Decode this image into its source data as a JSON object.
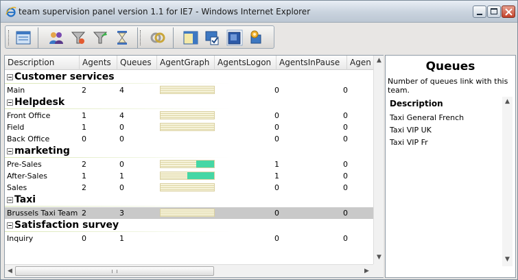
{
  "window": {
    "title": "team supervision panel version 1.1 for IE7 - Windows Internet Explorer"
  },
  "toolbar": {
    "icons": [
      "layout-icon",
      "team-icon",
      "funnel-icon",
      "filter-icon",
      "hourglass-icon",
      "rings-icon",
      "panel-icon",
      "checkbox-icon",
      "window-icon",
      "settings-icon"
    ]
  },
  "grid": {
    "columns": [
      "Description",
      "Agents",
      "Queues",
      "AgentGraph",
      "AgentsLogon",
      "AgentsInPause",
      "Agen"
    ],
    "groups": [
      {
        "name": "Customer services",
        "rows": [
          {
            "description": "Main",
            "agents": "2",
            "queues": "4",
            "logon": "0",
            "pause": "0",
            "graph_fill": 0
          }
        ]
      },
      {
        "name": "Helpdesk",
        "rows": [
          {
            "description": "Front Office",
            "agents": "1",
            "queues": "4",
            "logon": "0",
            "pause": "0",
            "graph_fill": 0
          },
          {
            "description": "Field",
            "agents": "1",
            "queues": "0",
            "logon": "0",
            "pause": "0",
            "graph_fill": 0
          },
          {
            "description": "Back Office",
            "agents": "0",
            "queues": "0",
            "logon": "0",
            "pause": "0",
            "graph_fill": null
          }
        ]
      },
      {
        "name": "marketing",
        "rows": [
          {
            "description": "Pre-Sales",
            "agents": "2",
            "queues": "0",
            "logon": "1",
            "pause": "0",
            "graph_fill": 0.33
          },
          {
            "description": "After-Sales",
            "agents": "1",
            "queues": "1",
            "logon": "1",
            "pause": "0",
            "graph_fill": 0.5
          },
          {
            "description": "Sales",
            "agents": "2",
            "queues": "0",
            "logon": "0",
            "pause": "0",
            "graph_fill": 0
          }
        ]
      },
      {
        "name": "Taxi",
        "rows": [
          {
            "description": "Brussels Taxi Team",
            "agents": "2",
            "queues": "3",
            "logon": "0",
            "pause": "0",
            "graph_fill": 0,
            "selected": true
          }
        ]
      },
      {
        "name": "Satisfaction survey",
        "rows": [
          {
            "description": "Inquiry",
            "agents": "0",
            "queues": "1",
            "logon": "0",
            "pause": "0",
            "graph_fill": null
          }
        ]
      }
    ]
  },
  "side": {
    "title": "Queues",
    "description": "Number of queues link with this team.",
    "list_header": "Description",
    "items": [
      "Taxi General French",
      "Taxi VIP UK",
      "Taxi VIP Fr"
    ]
  },
  "colors": {
    "graph_fill": "#45d7a5",
    "selected_row": "#c9c9c9"
  }
}
